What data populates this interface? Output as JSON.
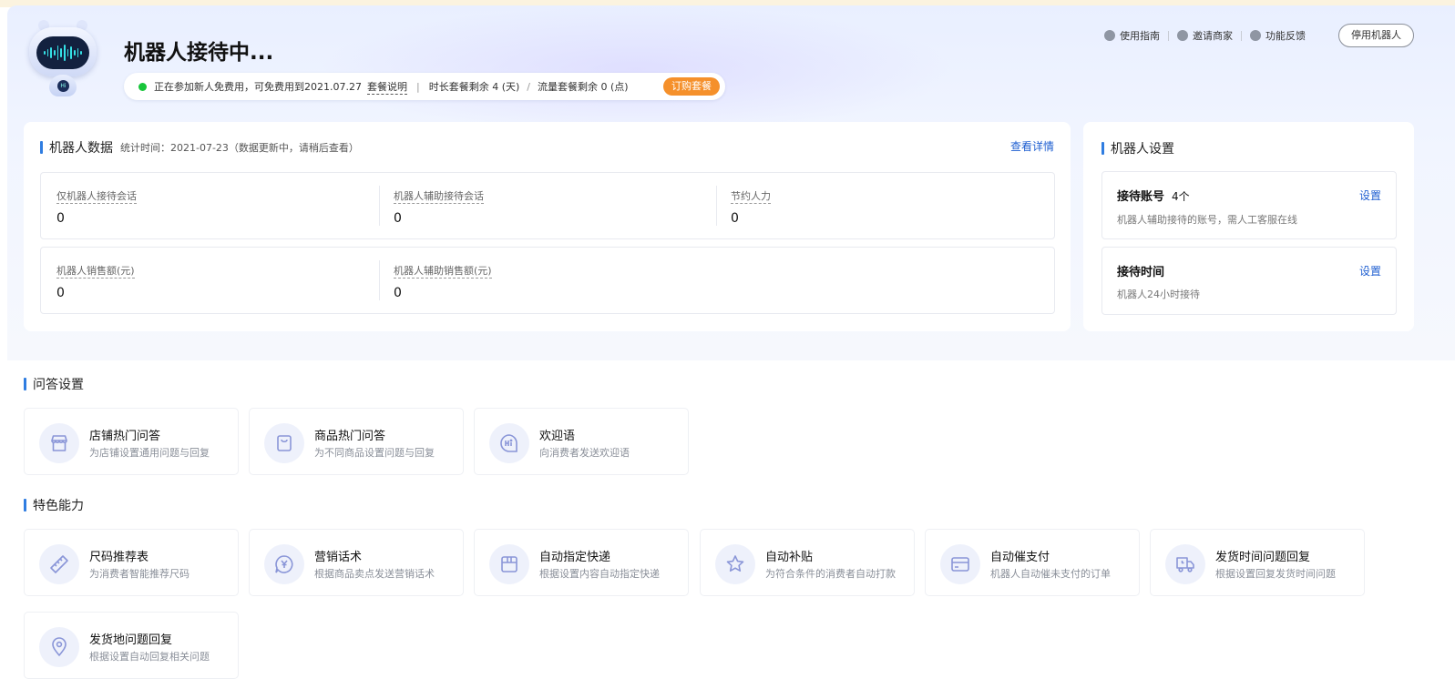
{
  "header": {
    "title": "机器人接待中...",
    "status": {
      "text": "正在参加新人免费用，可免费用到2021.07.27",
      "plan_link": "套餐说明",
      "time_remaining": "时长套餐剩余 4 (天)",
      "divider": "/",
      "flow_remaining": "流量套餐剩余 0 (点)",
      "buy_label": "订购套餐"
    },
    "links": [
      {
        "label": "使用指南",
        "icon": "compass-icon"
      },
      {
        "label": "邀请商家",
        "icon": "send-icon"
      },
      {
        "label": "功能反馈",
        "icon": "chat-icon"
      }
    ],
    "stop_label": "停用机器人"
  },
  "robot_data": {
    "title": "机器人数据",
    "subtitle": "统计时间：2021-07-23（数据更新中，请稍后查看）",
    "detail_link": "查看详情",
    "row1": [
      {
        "label": "仅机器人接待会话",
        "value": "0"
      },
      {
        "label": "机器人辅助接待会话",
        "value": "0"
      },
      {
        "label": "节约人力",
        "value": "0"
      }
    ],
    "row2": [
      {
        "label": "机器人销售额(元)",
        "value": "0"
      },
      {
        "label": "机器人辅助销售额(元)",
        "value": "0"
      }
    ]
  },
  "robot_settings": {
    "title": "机器人设置",
    "items": [
      {
        "name": "接待账号",
        "count": "4个",
        "desc": "机器人辅助接待的账号，需人工客服在线",
        "action": "设置"
      },
      {
        "name": "接待时间",
        "count": "",
        "desc": "机器人24小时接待",
        "action": "设置"
      }
    ]
  },
  "qa_settings": {
    "title": "问答设置",
    "items": [
      {
        "title": "店铺热门问答",
        "desc": "为店铺设置通用问题与回复",
        "icon": "store-icon"
      },
      {
        "title": "商品热门问答",
        "desc": "为不同商品设置问题与回复",
        "icon": "bag-icon"
      },
      {
        "title": "欢迎语",
        "desc": "向消费者发送欢迎语",
        "icon": "hi-chat-icon"
      }
    ]
  },
  "features": {
    "title": "特色能力",
    "items": [
      {
        "title": "尺码推荐表",
        "desc": "为消费者智能推荐尺码",
        "icon": "ruler-icon"
      },
      {
        "title": "营销话术",
        "desc": "根据商品卖点发送营销话术",
        "icon": "yen-chat-icon"
      },
      {
        "title": "自动指定快递",
        "desc": "根据设置内容自动指定快递",
        "icon": "box-icon"
      },
      {
        "title": "自动补贴",
        "desc": "为符合条件的消费者自动打款",
        "icon": "star-icon"
      },
      {
        "title": "自动催支付",
        "desc": "机器人自动催未支付的订单",
        "icon": "card-icon"
      },
      {
        "title": "发货时间问题回复",
        "desc": "根据设置回复发货时间问题",
        "icon": "truck-clock-icon"
      },
      {
        "title": "发货地问题回复",
        "desc": "根据设置自动回复相关问题",
        "icon": "location-pin-icon"
      }
    ]
  }
}
